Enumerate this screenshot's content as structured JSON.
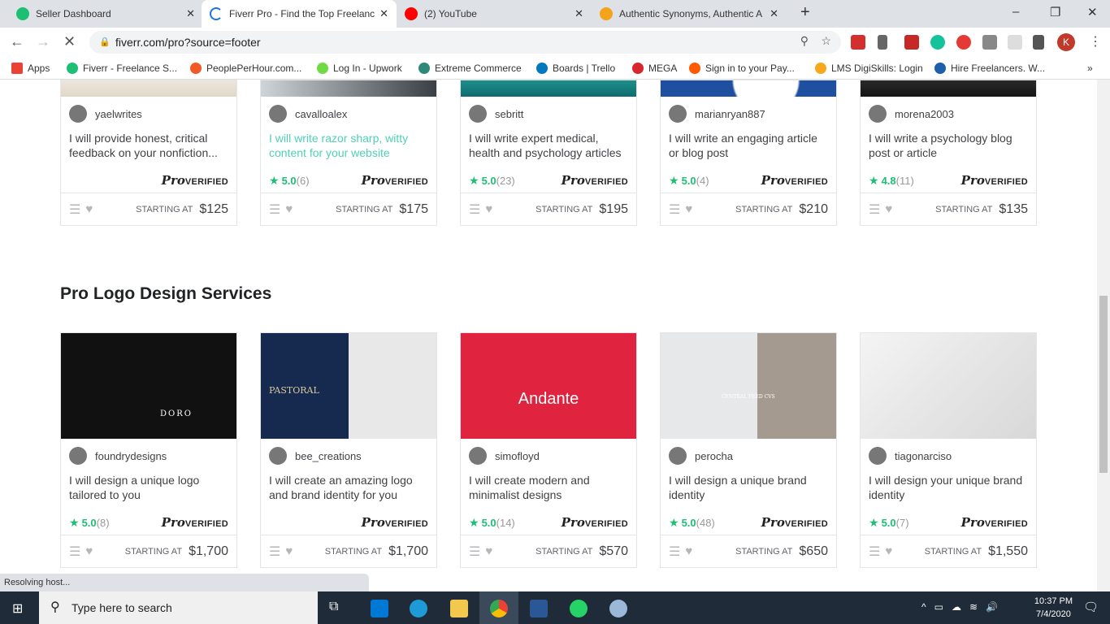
{
  "tabs": [
    {
      "title": "Seller Dashboard",
      "icon": "fiverr-icon",
      "color": "#1dbf73",
      "active": false
    },
    {
      "title": "Fiverr Pro - Find the Top Freelanc",
      "icon": "loading-spinner-icon",
      "color": "#1a73e8",
      "active": true
    },
    {
      "title": "(2) YouTube",
      "icon": "youtube-icon",
      "color": "#ff0000",
      "active": false
    },
    {
      "title": "Authentic Synonyms, Authentic A",
      "icon": "thesaurus-icon",
      "color": "#f4a31b",
      "active": false
    }
  ],
  "address": "fiverr.com/pro?source=footer",
  "bookmarks": [
    {
      "label": "Apps",
      "color": "#ea4335"
    },
    {
      "label": "Fiverr - Freelance S...",
      "color": "#1dbf73"
    },
    {
      "label": "PeoplePerHour.com...",
      "color": "#f15a24"
    },
    {
      "label": "Log In - Upwork",
      "color": "#6fda44"
    },
    {
      "label": "Extreme Commerce",
      "color": "#2d8a7a"
    },
    {
      "label": "Boards | Trello",
      "color": "#0079bf"
    },
    {
      "label": "MEGA",
      "color": "#d9272e"
    },
    {
      "label": "Sign in to your Pay...",
      "color": "#ff5a00"
    },
    {
      "label": "LMS DigiSkills: Login",
      "color": "#f7a81b"
    },
    {
      "label": "Hire Freelancers. W...",
      "color": "#1d5fa8"
    }
  ],
  "section_title": "Pro Logo Design Services",
  "pro_label": {
    "pro": "Pro",
    "verified": "VERIFIED"
  },
  "starting_at": "STARTING AT",
  "writing_cards": [
    {
      "seller": "yaelwrites",
      "title": "I will provide honest, critical feedback on your nonfiction...",
      "rating": "",
      "reviews": "",
      "price": "$125",
      "img": "linear-gradient(#ece6dc,#e0d7c8)",
      "hl": false
    },
    {
      "seller": "cavalloalex",
      "title": "I will write razor sharp, witty content for your website",
      "rating": "5.0",
      "reviews": "(6)",
      "price": "$175",
      "img": "linear-gradient(90deg,#cfd4d8,#3a3f45)",
      "hl": true
    },
    {
      "seller": "sebritt",
      "title": "I will write expert medical, health and psychology articles",
      "rating": "5.0",
      "reviews": "(23)",
      "price": "$195",
      "img": "linear-gradient(#1c8f8a,#0f6c70)",
      "hl": false
    },
    {
      "seller": "marianryan887",
      "title": "I will write an engaging article or blog post",
      "rating": "5.0",
      "reviews": "(4)",
      "price": "$210",
      "img": "radial-gradient(circle at 60% 0%,#fff 30%,#1f4fa0 32%)",
      "hl": false
    },
    {
      "seller": "morena2003",
      "title": "I will write a psychology blog post or article",
      "rating": "4.8",
      "reviews": "(11)",
      "price": "$135",
      "img": "linear-gradient(#2a2a2a,#151515)",
      "hl": false
    }
  ],
  "logo_cards": [
    {
      "seller": "foundrydesigns",
      "title": "I will design a unique logo tailored to you",
      "rating": "5.0",
      "reviews": "(8)",
      "price": "$1,700",
      "img": "#111",
      "hl": false,
      "logo_text": "DORO"
    },
    {
      "seller": "bee_creations",
      "title": "I will create an amazing logo and brand identity for you",
      "rating": "",
      "reviews": "",
      "price": "$1,700",
      "img": "linear-gradient(90deg,#16294f 50%,#e8e8e8 50%)",
      "hl": false,
      "logo_text": "PASTORAL"
    },
    {
      "seller": "simofloyd",
      "title": "I will create modern and minimalist designs",
      "rating": "5.0",
      "reviews": "(14)",
      "price": "$570",
      "img": "#e0243f",
      "hl": false,
      "logo_text": "Andante"
    },
    {
      "seller": "perocha",
      "title": "I will design a unique brand identity",
      "rating": "5.0",
      "reviews": "(48)",
      "price": "$650",
      "img": "linear-gradient(90deg,#e6e8ea 55%,#a59a90 55%)",
      "hl": false,
      "logo_text": "CENTRAL FEED CVS"
    },
    {
      "seller": "tiagonarciso",
      "title": "I will design your unique brand identity",
      "rating": "5.0",
      "reviews": "(7)",
      "price": "$1,550",
      "img": "linear-gradient(135deg,#f4f4f4,#d8d8d8)",
      "hl": false,
      "logo_text": ""
    }
  ],
  "status_text": "Resolving host...",
  "taskbar": {
    "search_placeholder": "Type here to search",
    "time": "10:37 PM",
    "date": "7/4/2020"
  },
  "profile_initial": "K"
}
